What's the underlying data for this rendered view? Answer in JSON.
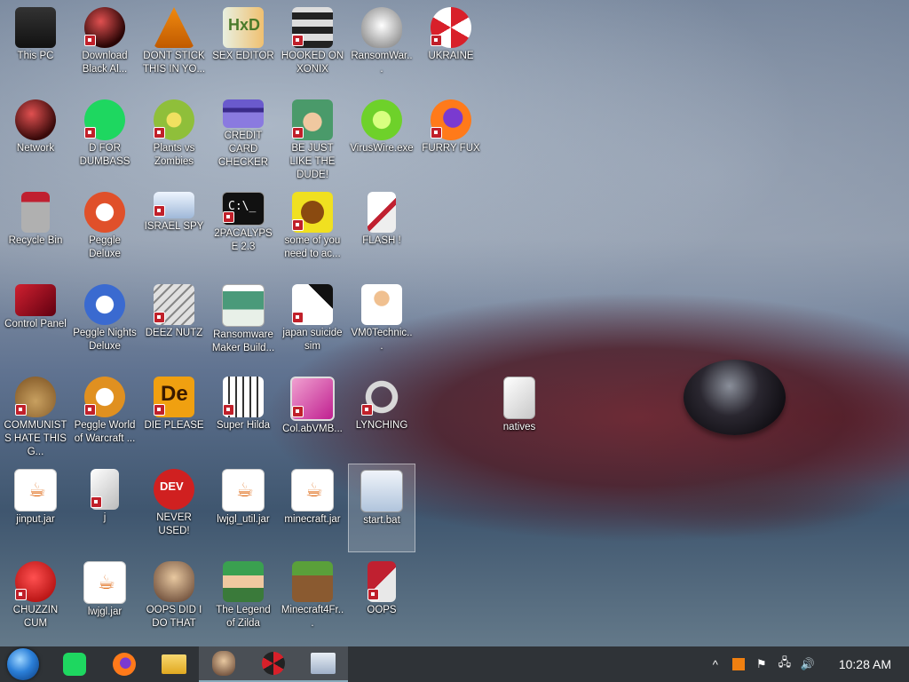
{
  "desktop": {
    "icons": [
      {
        "label": "This PC",
        "icon": "computer-icon",
        "color": "#2a2a2a"
      },
      {
        "label": "Download Black Al...",
        "icon": "black-orb-icon",
        "color": "#5a1a1a"
      },
      {
        "label": "DONT STICK THIS IN YO...",
        "icon": "traffic-cone-icon",
        "color": "#f08a10"
      },
      {
        "label": "SEX EDITOR",
        "icon": "hxd-icon",
        "color": "#e8e8e8"
      },
      {
        "label": "HOOKED ON XONIX",
        "icon": "xonix-icon",
        "color": "#cfcfcf"
      },
      {
        "label": "RansomWar...",
        "icon": "skull-icon",
        "color": "#d0d0d0"
      },
      {
        "label": "UKRAINE",
        "icon": "radiation-icon",
        "color": "#d8202a"
      },
      {
        "label": "Network",
        "icon": "black-orb-icon",
        "color": "#4a1a1a"
      },
      {
        "label": "D FOR DUMBASS",
        "icon": "spotify-style-icon",
        "color": "#1ed760"
      },
      {
        "label": "Plants vs Zombies",
        "icon": "flower-icon",
        "color": "#8fbf3a"
      },
      {
        "label": "CREDIT CARD CHECKER",
        "icon": "credit-card-icon",
        "color": "#6a5acd"
      },
      {
        "label": "BE JUST LIKE THE DUDE!",
        "icon": "elf-icon",
        "color": "#4a9a6a"
      },
      {
        "label": "VirusWire.exe",
        "icon": "lime-icon",
        "color": "#6ed12a"
      },
      {
        "label": "FURRY FUX",
        "icon": "firefox-icon",
        "color": "#ff7a1a"
      },
      {
        "label": "Recycle Bin",
        "icon": "recycle-bin-icon",
        "color": "#b0b0b0"
      },
      {
        "label": "Peggle Deluxe",
        "icon": "peggle-icon",
        "color": "#e0502a"
      },
      {
        "label": "ISRAEL SPY",
        "icon": "network-spy-icon",
        "color": "#cfe0f0"
      },
      {
        "label": "2PACALYPSE 2.3",
        "icon": "terminal-icon",
        "color": "#111111"
      },
      {
        "label": "some of you need to ac...",
        "icon": "dog-icon",
        "color": "#c8a020"
      },
      {
        "label": "FLASH !",
        "icon": "flash-icon",
        "color": "#f0f0f0"
      },
      {
        "label": "Control Panel",
        "icon": "control-panel-icon",
        "color": "#c0202a"
      },
      {
        "label": "Peggle Nights Deluxe",
        "icon": "peggle-icon",
        "color": "#3a6ad0"
      },
      {
        "label": "DEEZ NUTZ",
        "icon": "stack-icon",
        "color": "#c8c8c8"
      },
      {
        "label": "Ransomware Maker Build...",
        "icon": "window-icon",
        "color": "#e0e8e0"
      },
      {
        "label": "japan suicide sim",
        "icon": "japan-icon",
        "color": "#ffffff"
      },
      {
        "label": "VM0Technic...",
        "icon": "doctor-icon",
        "color": "#e0b080"
      },
      {
        "label": "COMMUNISTS HATE THIS G...",
        "icon": "money-bag-icon",
        "color": "#b08040"
      },
      {
        "label": "Peggle World of Warcraft ...",
        "icon": "peggle-icon",
        "color": "#e09020"
      },
      {
        "label": "DIE PLEASE",
        "icon": "de-icon",
        "color": "#f0a010"
      },
      {
        "label": "Super Hilda",
        "icon": "pixel-sprite-icon",
        "color": "#f0f0f0"
      },
      {
        "label": "Col.abVMB...",
        "icon": "tv-icon",
        "color": "#d040a0"
      },
      {
        "label": "LYNCHING",
        "icon": "noose-icon",
        "color": "#d8d8d8"
      },
      {
        "label": "jinput.jar",
        "icon": "java-icon",
        "color": "#ffffff"
      },
      {
        "label": "j",
        "icon": "flash-icon",
        "color": "#e8e8e8"
      },
      {
        "label": "NEVER USED!",
        "icon": "devcpp-icon",
        "color": "#d02020"
      },
      {
        "label": "lwjgl_util.jar",
        "icon": "java-icon",
        "color": "#ffffff"
      },
      {
        "label": "minecraft.jar",
        "icon": "java-icon",
        "color": "#ffffff"
      },
      {
        "label": "start.bat",
        "icon": "batch-gear-icon",
        "color": "#d0e0f0"
      },
      {
        "label": "CHUZZIN CUM",
        "icon": "chuzzle-icon",
        "color": "#e02020"
      },
      {
        "label": "lwjgl.jar",
        "icon": "java-icon",
        "color": "#ffffff"
      },
      {
        "label": "OOPS DID I DO THAT",
        "icon": "portrait-icon",
        "color": "#c8a080"
      },
      {
        "label": "The Legend of Zilda",
        "icon": "link-sprite-icon",
        "color": "#3aa050"
      },
      {
        "label": "Minecraft4Fr...",
        "icon": "grass-block-icon",
        "color": "#6a9a3a"
      },
      {
        "label": "OOPS",
        "icon": "flash-icon",
        "color": "#c02030"
      },
      {
        "label": "natives",
        "icon": "folder-icon",
        "color": "#e8e8e8"
      }
    ]
  },
  "taskbar": {
    "buttons": [
      {
        "name": "spotify-style",
        "color": "#1ed760"
      },
      {
        "name": "firefox",
        "color": "#ff7a1a"
      },
      {
        "name": "file-explorer",
        "color": "#f0c040"
      },
      {
        "name": "portrait",
        "color": "#c8a080"
      },
      {
        "name": "radiation",
        "color": "#d8202a"
      },
      {
        "name": "task-manager",
        "color": "#a0b8d0"
      }
    ],
    "clock": "10:28 AM"
  }
}
